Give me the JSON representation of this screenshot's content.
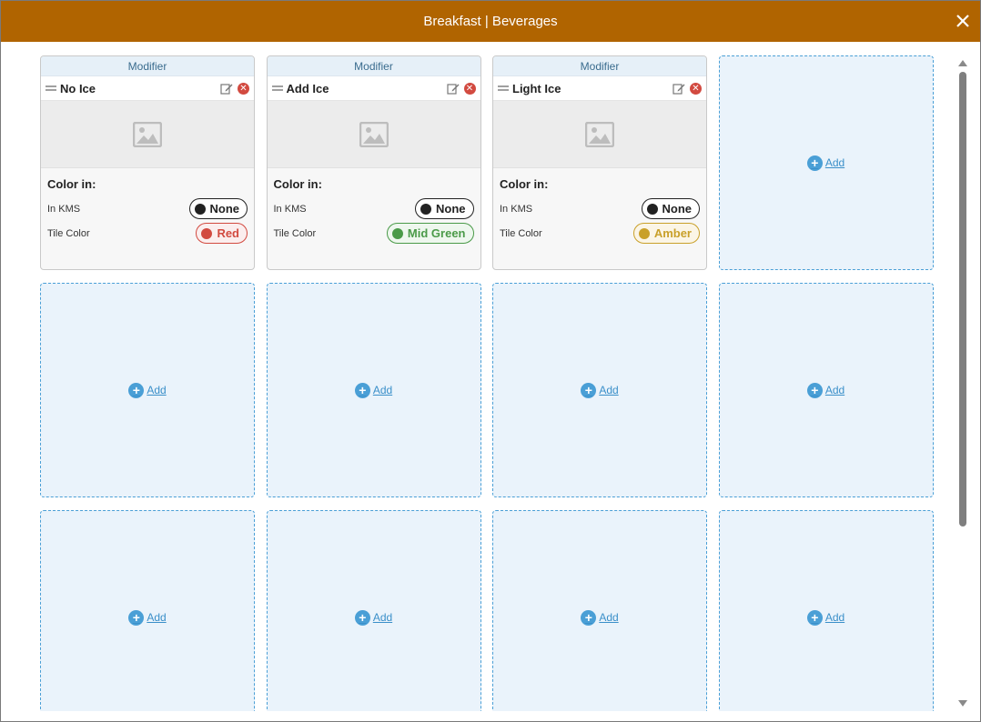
{
  "window": {
    "title": "Breakfast | Beverages"
  },
  "tiles": [
    {
      "type_label": "Modifier",
      "name": "No Ice",
      "color_heading": "Color in:",
      "kms": {
        "label": "In KMS",
        "value": "None",
        "color": "#222222"
      },
      "tile_color": {
        "label": "Tile Color",
        "value": "Red",
        "color": "#d24a40"
      }
    },
    {
      "type_label": "Modifier",
      "name": "Add Ice",
      "color_heading": "Color in:",
      "kms": {
        "label": "In KMS",
        "value": "None",
        "color": "#222222"
      },
      "tile_color": {
        "label": "Tile Color",
        "value": "Mid Green",
        "color": "#4a9a48"
      }
    },
    {
      "type_label": "Modifier",
      "name": "Light Ice",
      "color_heading": "Color in:",
      "kms": {
        "label": "In KMS",
        "value": "None",
        "color": "#222222"
      },
      "tile_color": {
        "label": "Tile Color",
        "value": "Amber",
        "color": "#c9a02a"
      }
    }
  ],
  "add_label": "Add",
  "empty_tile_count": 9
}
